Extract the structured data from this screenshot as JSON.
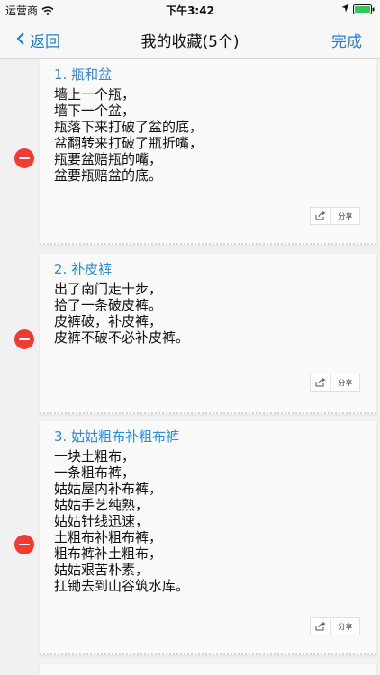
{
  "status": {
    "carrier": "运营商",
    "time": "下午3:42"
  },
  "nav": {
    "back_label": "返回",
    "title": "我的收藏(5个)",
    "done_label": "完成"
  },
  "colors": {
    "accent": "#1e7fd6",
    "delete": "#f03a32",
    "battery": "#34c759"
  },
  "favorites": [
    {
      "title": "1. 瓶和盆",
      "body": "墙上一个瓶，\n墙下一个盆，\n瓶落下来打破了盆的底，\n盆翻转来打破了瓶折嘴，\n瓶要盆赔瓶的嘴，\n盆要瓶赔盆的底。",
      "share_label": "分享"
    },
    {
      "title": "2. 补皮裤",
      "body": "出了南门走十步，\n拾了一条破皮裤。\n皮裤破，补皮裤，\n皮裤不破不必补皮裤。",
      "share_label": "分享"
    },
    {
      "title": "3. 姑姑粗布补粗布裤",
      "body": "一块土粗布，\n一条粗布裤，\n姑姑屋内补布裤，\n姑姑手艺纯熟，\n姑姑针线迅速，\n土粗布补粗布裤，\n粗布裤补土粗布，\n姑姑艰苦朴素，\n扛锄去到山谷筑水库。",
      "share_label": "分享"
    }
  ]
}
